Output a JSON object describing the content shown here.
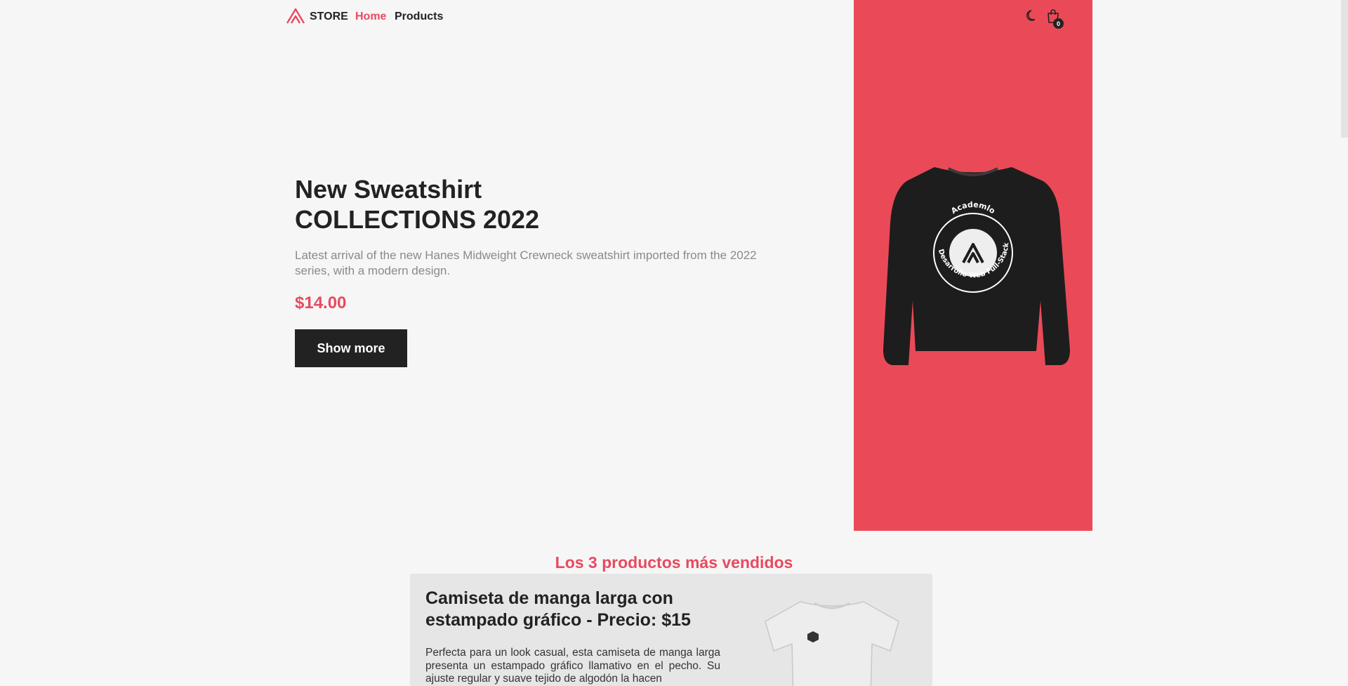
{
  "header": {
    "brand": "STORE",
    "nav": {
      "home": "Home",
      "products": "Products"
    },
    "cart_count": "0",
    "icons": [
      "logo-icon",
      "moon-icon",
      "shopping-bag-icon"
    ]
  },
  "hero": {
    "title_line1": "New Sweatshirt",
    "title_line2": "COLLECTIONS 2022",
    "description": "Latest arrival of the new Hanes Midweight Crewneck sweatshirt imported from the 2022 series, with a modern design.",
    "price": "$14.00",
    "button": "Show more",
    "image_logo_text": "Academlo",
    "image_ring_text": "Desarrollo Web Full-Stack"
  },
  "bestsellers": {
    "heading": "Los 3 productos más vendidos",
    "card": {
      "title": "Camiseta de manga larga con estampado gráfico - Precio: $15",
      "description": "Perfecta para un look casual, esta camiseta de manga larga presenta un estampado gráfico llamativo en el pecho. Su ajuste regular y suave tejido de algodón la hacen"
    }
  },
  "colors": {
    "accent": "#e84a5f",
    "panel": "#ea4a58",
    "dark": "#222222",
    "background": "#f6f6f6"
  }
}
